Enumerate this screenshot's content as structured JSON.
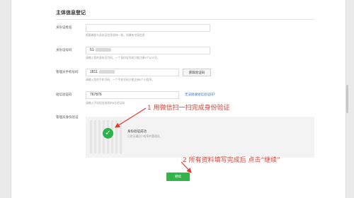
{
  "page": {
    "section_title": "主体信息登记"
  },
  "form": {
    "id_name": {
      "label": "身份证姓名",
      "value": "",
      "hint": "需要确保与身份证信息保持一致，如果有字段信息"
    },
    "id_number": {
      "label": "身份证号码",
      "value": "51",
      "hint": "请输入您的身份证号码。一个身份证号码只能注册5个公众号。"
    },
    "admin_phone": {
      "label": "管理员手机号码",
      "value": "1811",
      "get_code_button": "获取验证码",
      "hint": "请输入您的手机号码，一个手机号码只能注册5个小程序。"
    },
    "sms_code": {
      "label": "短信验证码",
      "value": "767876",
      "no_code_link": "无法接收短信验证码？",
      "hint": "请输入手机短信收到的6位验证码"
    },
    "identity_verification": {
      "label": "管理员身份验证",
      "status_title": "身份验证成功",
      "status_sub": "已验证通过小程序的管理员。"
    },
    "continue_button": "继续"
  },
  "annotations": {
    "step1": "1 用微信扫一扫完成身份验证",
    "step2": "2 所有资料填写完成后 点击“继续”"
  },
  "colors": {
    "accent_green": "#36b24a",
    "annotation_red": "#e03a2f",
    "link_blue": "#2c6fd1"
  }
}
